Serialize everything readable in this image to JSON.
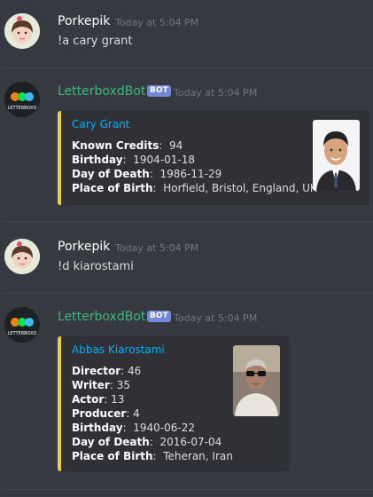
{
  "messages": [
    {
      "author": "Porkepik",
      "timestamp": "Today at 5:04 PM",
      "text": "!a cary grant"
    },
    {
      "author": "LetterboxdBot",
      "tag": "BOT",
      "timestamp": "Today at 5:04 PM",
      "avatar_text": "LETTERBOXD",
      "embed": {
        "title": "Cary Grant",
        "fields": [
          {
            "label": "Known Credits",
            "sep": ":  ",
            "value": "94"
          },
          {
            "label": "Birthday",
            "sep": ":  ",
            "value": "1904-01-18"
          },
          {
            "label": "Day of Death",
            "sep": ":  ",
            "value": "1986-11-29"
          },
          {
            "label": "Place of Birth",
            "sep": ":  ",
            "value": "Horfield, Bristol, England, UK"
          }
        ]
      }
    },
    {
      "author": "Porkepik",
      "timestamp": "Today at 5:04 PM",
      "text": "!d kiarostami"
    },
    {
      "author": "LetterboxdBot",
      "tag": "BOT",
      "timestamp": "Today at 5:04 PM",
      "avatar_text": "LETTERBOXD",
      "embed": {
        "title": "Abbas Kiarostami",
        "fields": [
          {
            "label": "Director",
            "sep": ": ",
            "value": "46"
          },
          {
            "label": "Writer",
            "sep": ": ",
            "value": "35"
          },
          {
            "label": "Actor",
            "sep": ": ",
            "value": "13"
          },
          {
            "label": "Producer",
            "sep": ": ",
            "value": "4"
          },
          {
            "label": "Birthday",
            "sep": ":  ",
            "value": "1940-06-22"
          },
          {
            "label": "Day of Death",
            "sep": ":  ",
            "value": "2016-07-04"
          },
          {
            "label": "Place of Birth",
            "sep": ":  ",
            "value": "Teheran, Iran"
          }
        ]
      }
    }
  ],
  "colors": {
    "background": "#36393f",
    "bot_name": "#43b581",
    "embed_accent": "#f2c94c",
    "link": "#00b0f4",
    "bot_tag": "#7289da"
  }
}
